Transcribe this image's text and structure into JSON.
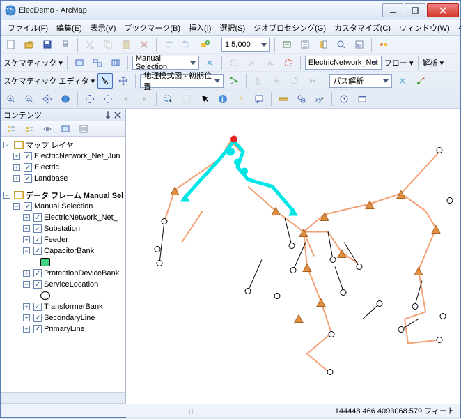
{
  "window": {
    "title": "ElecDemo - ArcMap"
  },
  "menu": {
    "file": "ファイル(F)",
    "edit": "編集(E)",
    "view": "表示(V)",
    "bookmark": "ブックマーク(B)",
    "insert": "挿入(I)",
    "select": "選択(S)",
    "geo": "ジオプロセシング(G)",
    "custom": "カスタマイズ(C)",
    "window": "ウィンドウ(W)",
    "help": "ヘルプ(H)"
  },
  "toolbar": {
    "scale": "1:5,000",
    "schematic_label": "スケマティック ▾",
    "manual_sel": "Manual Selection",
    "network": "ElectricNetwork_Net",
    "flow_label": "フロー ▾",
    "analysis_label": "解析 ▾",
    "editor_label": "スケマティック エディタ ▾",
    "geoview": "地理模式図 - 初期位置",
    "pathsolve": "パス解析"
  },
  "toc": {
    "title": "コンテンツ",
    "map_layers": "マップ レイヤ",
    "layers": {
      "l0": "ElectricNetwork_Net_Jun",
      "l1": "Electric",
      "l2": "Landbase"
    },
    "df_label": "データ フレーム Manual Sel",
    "manual_selection": "Manual Selection",
    "items": {
      "i0": "ElectricNetwork_Net_",
      "i1": "Substation",
      "i2": "Feeder",
      "i3": "CapacitorBank",
      "i4": "ProtectionDeviceBank",
      "i5": "ServiceLocation",
      "i6": "TransformerBank",
      "i7": "SecondaryLine",
      "i8": "PrimaryLine"
    }
  },
  "status": {
    "coords": "144448.466  4093068.579 フィート"
  },
  "icons": {
    "app": "earth-icon"
  }
}
